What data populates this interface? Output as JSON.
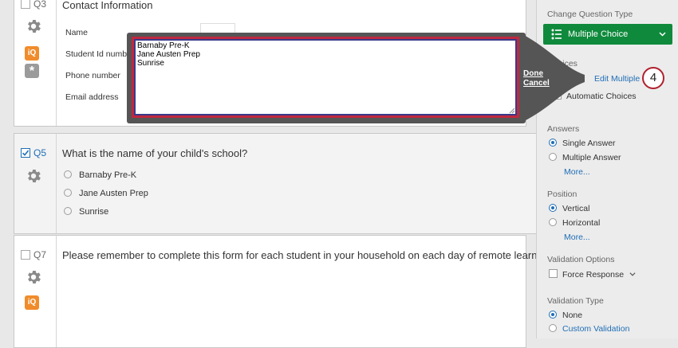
{
  "q3": {
    "num": "Q3",
    "title": "Contact Information",
    "fields": [
      "Name",
      "Student Id number",
      "Phone number",
      "Email address"
    ]
  },
  "q5": {
    "num": "Q5",
    "title": "What is the name of your child's school?",
    "choices": [
      "Barnaby Pre-K",
      "Jane Austen Prep",
      "Sunrise"
    ]
  },
  "q7": {
    "num": "Q7",
    "title": "Please remember to complete this form for each student in your household on each day of remote learning."
  },
  "overlay": {
    "text": "Barnaby Pre-K\nJane Austen Prep\nSunrise",
    "done_label": "Done",
    "cancel_label": "Cancel"
  },
  "panel": {
    "change_type_label": "Change Question Type",
    "type_value": "Multiple Choice",
    "choices_label": "Choices",
    "edit_multiple_label": "Edit Multiple",
    "automatic_choices_label": "Automatic Choices",
    "answers_label": "Answers",
    "answer_options": [
      "Single Answer",
      "Multiple Answer"
    ],
    "more_label": "More...",
    "position_label": "Position",
    "position_options": [
      "Vertical",
      "Horizontal"
    ],
    "validation_options_label": "Validation Options",
    "force_response_label": "Force Response",
    "validation_type_label": "Validation Type",
    "validation_type_options": [
      "None",
      "Custom Validation"
    ]
  },
  "badges": {
    "iq": "iQ",
    "star": "*"
  },
  "step_marker": "4",
  "colors": {
    "accent": "#1f6eb6",
    "brand_green": "#0f8a3c",
    "highlight_red": "#c0283f"
  }
}
